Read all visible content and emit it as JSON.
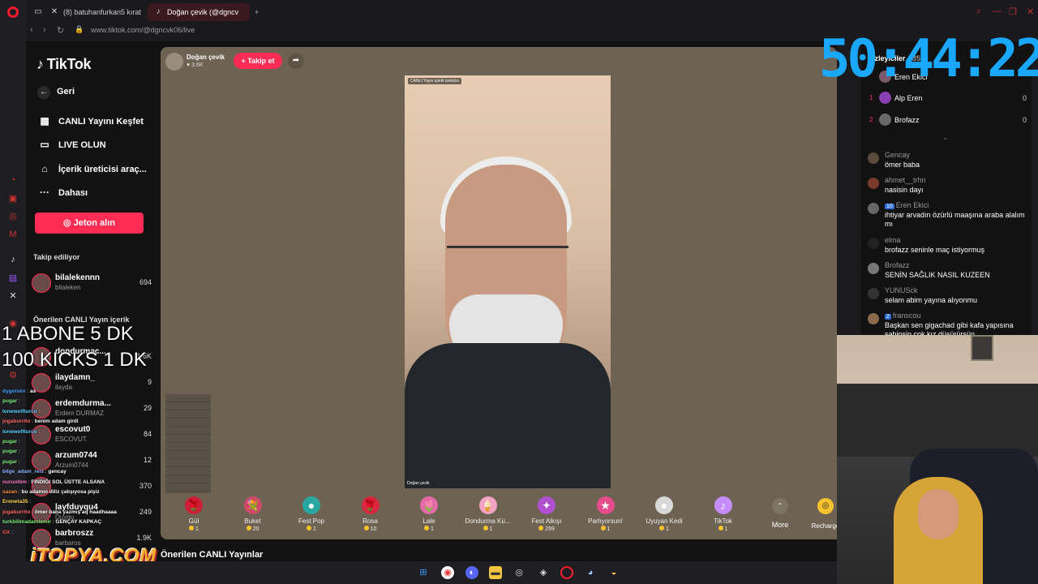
{
  "browser": {
    "tabs": [
      {
        "label": "(8) batuhanfurkan5 kırat",
        "icon": "x-icon"
      },
      {
        "label": "Doğan çevik (@dgncv",
        "icon": "tiktok-icon"
      }
    ],
    "url": "www.tiktok.com/@dgncvk06/live"
  },
  "nav": {
    "logo": "TikTok",
    "back": "Geri",
    "items": [
      {
        "label": "CANLI Yayını Keşfet",
        "icon": "calendar-icon"
      },
      {
        "label": "LIVE OLUN",
        "icon": "camera-icon"
      },
      {
        "label": "İçerik üreticisi araç...",
        "icon": "home-icon"
      },
      {
        "label": "Dahası",
        "icon": "more-icon"
      }
    ],
    "coin_button": "Jeton alın",
    "following_title": "Takip ediliyor",
    "suggested_title": "Önerilen CANLI Yayın içerik",
    "creators": [
      {
        "name": "bilalekennn",
        "sub": "bilaleken",
        "count": "694"
      },
      {
        "name": "dondurmac...",
        "sub": "",
        "count": "1.6K"
      },
      {
        "name": "ilaydamn_",
        "sub": "ilayda",
        "count": "9"
      },
      {
        "name": "erdemdurma...",
        "sub": "Erdem DURMAZ",
        "count": "29"
      },
      {
        "name": "escovut0",
        "sub": "ESCOVUT.",
        "count": "84"
      },
      {
        "name": "arzum0744",
        "sub": "Arzum0744",
        "count": "12"
      },
      {
        "name": "",
        "sub": "",
        "count": "370"
      },
      {
        "name": "layfduyqu4",
        "sub": "Duygu",
        "count": "249"
      },
      {
        "name": "barbroszz",
        "sub": "barbaros",
        "count": "1.9K"
      }
    ]
  },
  "live": {
    "host_name": "Doğan çevik",
    "host_likes": "3.6K",
    "follow": "+ Takip et",
    "video_tag": "CANLI Yayın içerik üreticisi",
    "video_name": "Doğan çevik",
    "gifts": [
      {
        "name": "Gül",
        "price": "1",
        "color": "#c91f37",
        "glyph": "🌹"
      },
      {
        "name": "Buket",
        "price": "20",
        "color": "#d04a6a",
        "glyph": "💐"
      },
      {
        "name": "Fest Pop",
        "price": "1",
        "color": "#2aa7a0",
        "glyph": "●"
      },
      {
        "name": "Rosa",
        "price": "10",
        "color": "#d8283f",
        "glyph": "🌹"
      },
      {
        "name": "Lale",
        "price": "1",
        "color": "#e46aa8",
        "glyph": "🌷"
      },
      {
        "name": "Dondurma Kü...",
        "price": "1",
        "color": "#f3a3c4",
        "glyph": "🍦"
      },
      {
        "name": "Fest Alkışı",
        "price": "299",
        "color": "#b04fd0",
        "glyph": "✦"
      },
      {
        "name": "Parlıyorsun!",
        "price": "1",
        "color": "#e64b8b",
        "glyph": "★"
      },
      {
        "name": "Uyuyan Kedi",
        "price": "1",
        "color": "#d8d8d8",
        "glyph": "●"
      },
      {
        "name": "TikTok",
        "price": "1",
        "color": "#c58cff",
        "glyph": "♪"
      }
    ],
    "more": "More",
    "recharge": "Recharge",
    "suggested_live": "Önerilen CANLI Yayınlar"
  },
  "ranking": {
    "title": "Izleyiciler",
    "count": "35",
    "rows": [
      {
        "rank": "",
        "name": "Eren Ekici",
        "value": ""
      },
      {
        "rank": "1",
        "name": "Alp Eren",
        "value": "0"
      },
      {
        "rank": "2",
        "name": "Brofazz",
        "value": "0"
      }
    ]
  },
  "chat": [
    {
      "user": "Gencay",
      "text": "ömer baba",
      "badge": ""
    },
    {
      "user": "ahmet__trhn",
      "text": "nasisin dayı",
      "badge": ""
    },
    {
      "user": "Eren Ekici",
      "text": "ihtiyar arvadın özürlü maaşına araba alalım mı",
      "badge": "10"
    },
    {
      "user": "elma",
      "text": "brofazz seninle maç istiyormuş",
      "badge": ""
    },
    {
      "user": "Brofazz",
      "text": "SENİN SAĞLIK NASIL KUZEEN",
      "badge": ""
    },
    {
      "user": "YUNUSck",
      "text": "selam abim yayına alıyonmu",
      "badge": ""
    },
    {
      "user": "franscou",
      "text": "Başkan sen gigachad gibi kafa yapısına sahipsin çok kız düşürürsün",
      "badge": "2"
    }
  ],
  "overlay": {
    "timer": "50:44:22",
    "line1": "1 ABONE 5 DK",
    "line2": "100 KICKS  1 DK",
    "brand": "iTOPYA.COM",
    "kick_chat": [
      {
        "user": "dygolskn",
        "text": "as",
        "color": "#4aa3ff"
      },
      {
        "user": "pugar",
        "text": "",
        "color": "#7ef07e"
      },
      {
        "user": "lonewolfturco",
        "text": "",
        "color": "#5ad6ff"
      },
      {
        "user": "jogaburrito",
        "text": "benim adam girdi",
        "color": "#ff6a6a"
      },
      {
        "user": "lonewolfturco",
        "text": "",
        "color": "#5ad6ff"
      },
      {
        "user": "pugar",
        "text": "",
        "color": "#7ef07e"
      },
      {
        "user": "pugar",
        "text": "",
        "color": "#7ef07e"
      },
      {
        "user": "pugar",
        "text": "",
        "color": "#7ef07e"
      },
      {
        "user": "bilge_adam_reis",
        "text": "gencay",
        "color": "#8fb5ff"
      },
      {
        "user": "nuruolbm",
        "text": "FINDIĞI SOL ÜSTTE ALSANA",
        "color": "#ff7ac4"
      },
      {
        "user": "sazan",
        "text": "bu adamın diliz çalışıyosa pişiz",
        "color": "#ff8f3a"
      },
      {
        "user": "Eroneta35",
        "text": "",
        "color": "#ffd54a"
      },
      {
        "user": "jogaburrito",
        "text": "ömer baba yazmış aq haadhaaaa",
        "color": "#ff6a6a"
      },
      {
        "user": "turkbillmadamlemir",
        "text": "GENÇAY KAPKAÇ",
        "color": "#7ef07e"
      },
      {
        "user": "GX",
        "text": "",
        "color": "#ff5a5a"
      }
    ]
  },
  "colors": {
    "accent": "#fe2c55",
    "timer": "#1aa8ff",
    "stage": "#6e6353"
  }
}
